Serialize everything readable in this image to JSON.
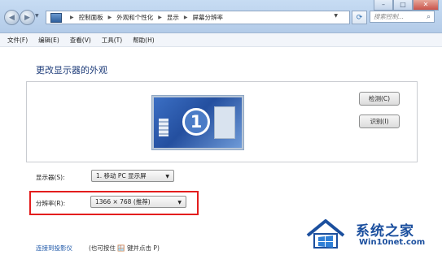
{
  "window": {
    "breadcrumb": [
      "控制面板",
      "外观和个性化",
      "显示",
      "屏幕分辨率"
    ],
    "search_placeholder": "搜索控制..."
  },
  "menu": [
    "文件(F)",
    "编辑(E)",
    "查看(V)",
    "工具(T)",
    "帮助(H)"
  ],
  "main": {
    "title": "更改显示器的外观",
    "monitor_number": "1",
    "detect_button": "检测(C)",
    "identify_button": "识别(I)",
    "display_label": "显示器(S):",
    "display_value": "1. 移动 PC 显示屏",
    "resolution_label": "分辨率(R):",
    "resolution_value": "1366 × 768 (推荐)",
    "bottom_link": "连接到投影仪",
    "bottom_note": "(也可按住 🪟 键并点击 P)"
  },
  "watermark": {
    "title": "系统之家",
    "url": "Win10net.com"
  },
  "colors": {
    "accent_title": "#1f3d7a",
    "highlight_border": "#e31d1d",
    "watermark": "#1b4f9e"
  }
}
